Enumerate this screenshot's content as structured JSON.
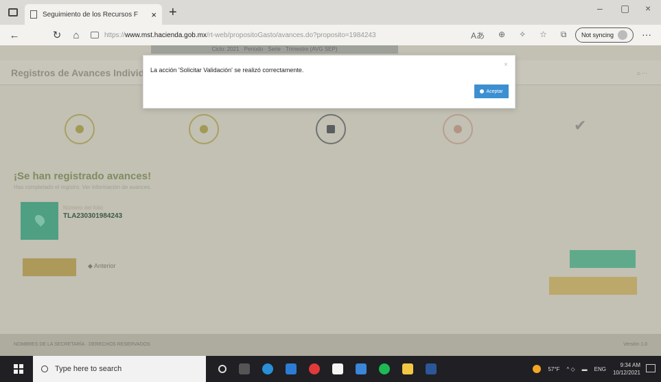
{
  "browser": {
    "tab_title": "Seguimiento de los Recursos F",
    "tab_close": "×",
    "new_tab": "+",
    "window_minimize": "–",
    "window_maximize": "▢",
    "window_close": "×",
    "url_prefix": "https://",
    "url_domain": "www.mst.hacienda.gob.mx",
    "url_path": "/rt-web/propositoGasto/avances.do?proposito=1984243",
    "not_syncing": "Not syncing",
    "more": "···"
  },
  "page": {
    "top_strip": "Ciclo: 2021 · Periodo · Serie · Trimestre (AVG SEP)",
    "title": "Registros de Avances Individual",
    "heading": "¡Se han registrado avances!",
    "subheading": "Has completado el registro. Ver información de avances.",
    "folio_label": "Número del folio",
    "folio": "TLA230301984243",
    "anterior": "Anterior",
    "footer_left": "NOMBRES DE LA SECRETARÍA · DERECHOS RESERVADOS",
    "footer_right": "Versión 1.0"
  },
  "modal": {
    "message": "La acción 'Solicitar Validación' se realizó correctamente.",
    "close": "×",
    "accept": "Aceptar"
  },
  "taskbar": {
    "search_placeholder": "Type here to search",
    "temperature": "57°F",
    "lang": "ENG",
    "time": "9:34 AM",
    "date": "10/12/2021"
  }
}
